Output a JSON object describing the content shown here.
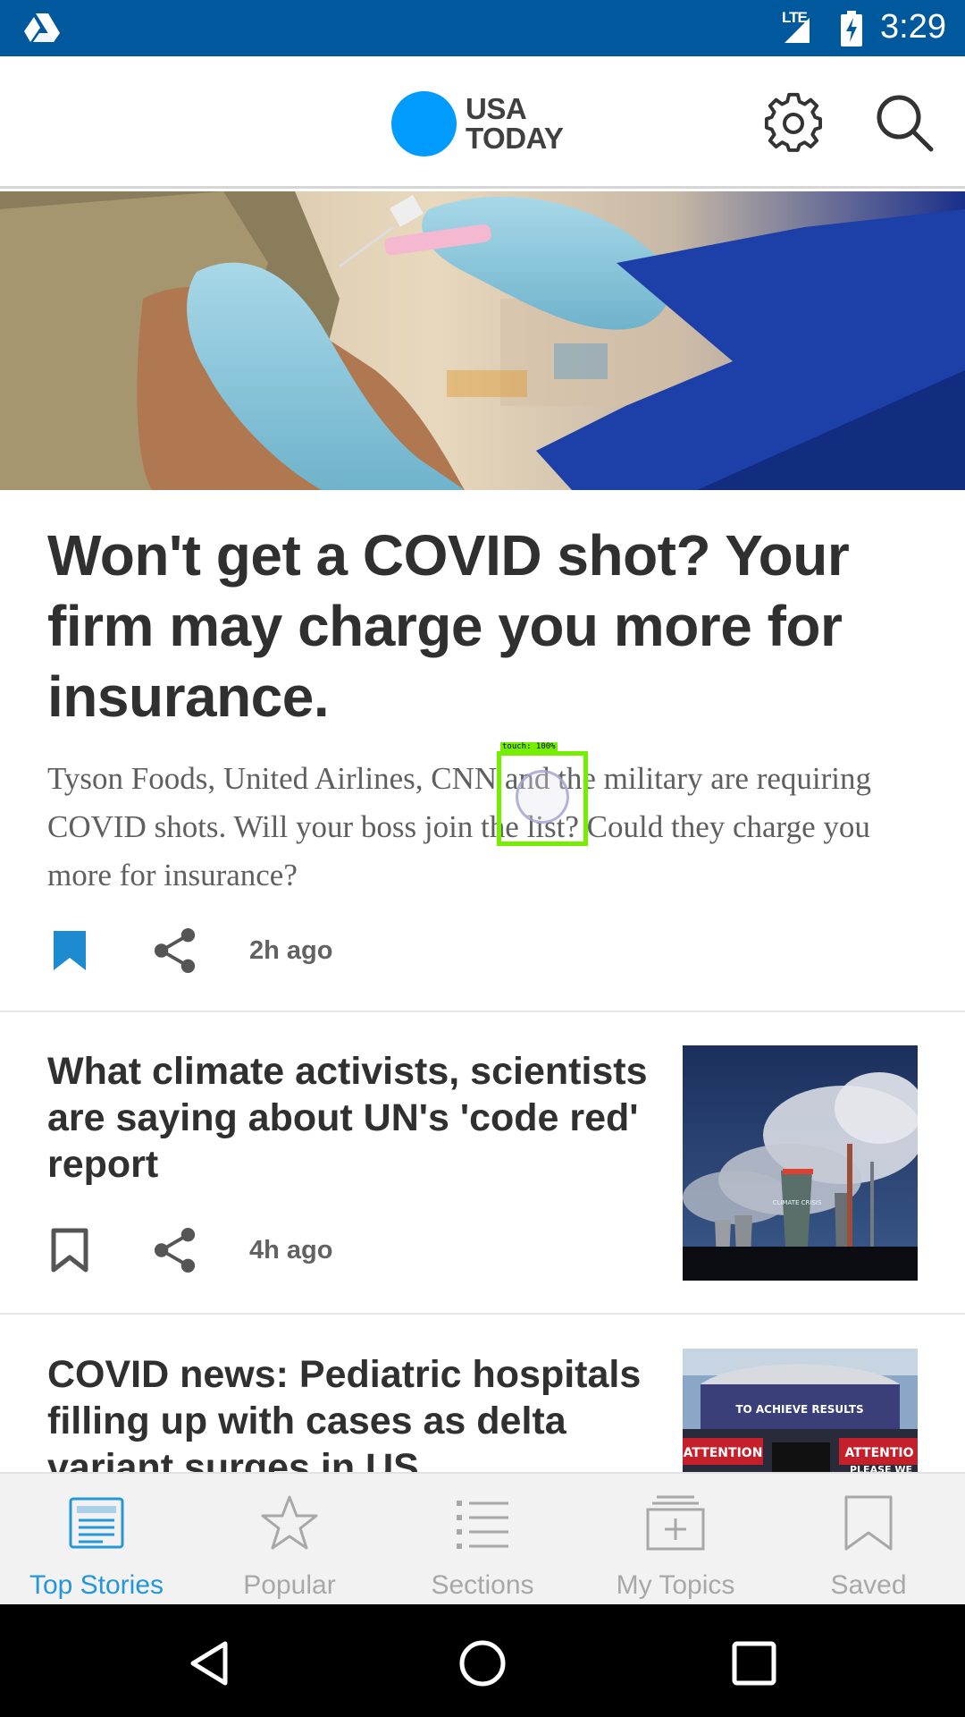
{
  "status_bar": {
    "network": "LTE",
    "time": "3:29"
  },
  "header": {
    "logo_line1": "USA",
    "logo_line2": "TODAY",
    "logo_color": "#009bff"
  },
  "lead_story": {
    "image_icon": "vaccination-photo",
    "title": "Won't get a COVID shot? Your firm may charge you more for insurance.",
    "summary": "Tyson Foods, United Airlines, CNN and the military are requiring COVID shots. Will your boss join the list? Could they charge you more for insurance?",
    "bookmarked": true,
    "time_ago": "2h ago"
  },
  "stories": [
    {
      "title": "What climate activists, scientists are saying about UN's 'code red' report",
      "image_icon": "power-plant-photo",
      "thumb_caption": "CLIMATE CRISIS",
      "bookmarked": false,
      "time_ago": "4h ago"
    },
    {
      "title": "COVID news: Pediatric hospitals filling up with cases as delta variant surges in US",
      "image_icon": "protest-stage-photo",
      "thumb_sign_1": "TO ACHIEVE RESULTS",
      "thumb_sign_2": "ATTENTION",
      "thumb_sign_3": "ATTENTIO",
      "thumb_sign_4": "PLEASE WE"
    }
  ],
  "bottom_nav": {
    "active_color": "#2596d8",
    "items": [
      {
        "label": "Top Stories",
        "icon": "newspaper-icon",
        "active": true
      },
      {
        "label": "Popular",
        "icon": "star-icon",
        "active": false
      },
      {
        "label": "Sections",
        "icon": "list-icon",
        "active": false
      },
      {
        "label": "My Topics",
        "icon": "add-topic-icon",
        "active": false
      },
      {
        "label": "Saved",
        "icon": "bookmark-icon",
        "active": false
      }
    ]
  },
  "touch_indicator": {
    "label": "touch: 100%"
  }
}
